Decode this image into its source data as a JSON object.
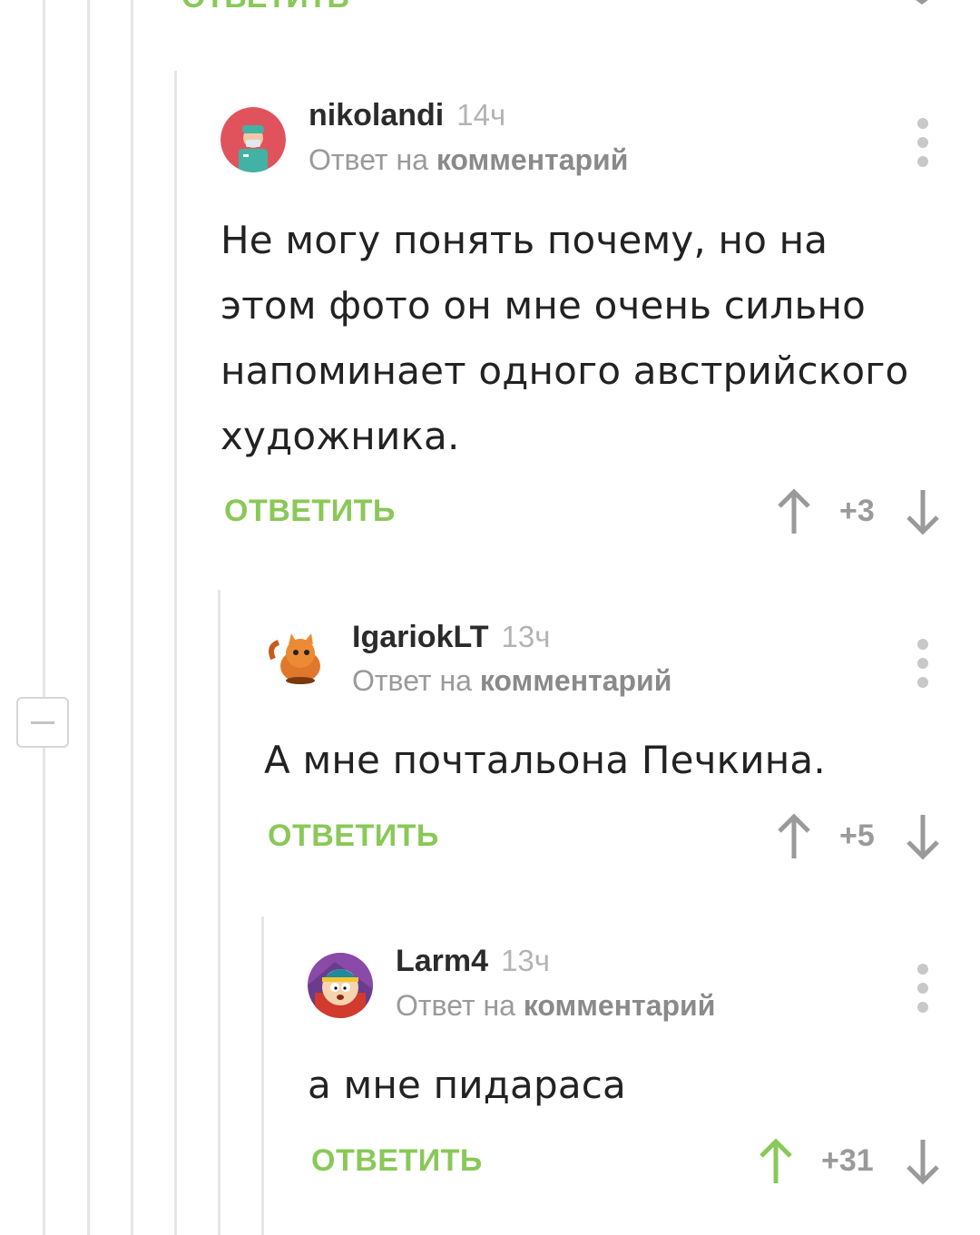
{
  "colors": {
    "accent_green": "#8ac858",
    "muted": "#9a9a9a",
    "thread_line": "#e6e6e6"
  },
  "top_partial": {
    "reply_label": "ОТВЕТИТЬ"
  },
  "collapse_button": {
    "icon": "minus-icon"
  },
  "comments": [
    {
      "author": "nikolandi",
      "time": "14ч",
      "reply_prefix": "Ответ на",
      "reply_link": "комментарий",
      "body_lines": [
        "Не могу понять почему, но на",
        "этом фото он мне очень сильно",
        "напоминает одного австрийского",
        "художника."
      ],
      "reply_label": "ОТВЕТИТЬ",
      "score": "+3",
      "upvoted": false
    },
    {
      "author": "IgariokLT",
      "time": "13ч",
      "reply_prefix": "Ответ на",
      "reply_link": "комментарий",
      "body_lines": [
        "А мне почтальона Печкина."
      ],
      "reply_label": "ОТВЕТИТЬ",
      "score": "+5",
      "upvoted": false
    },
    {
      "author": "Larm4",
      "time": "13ч",
      "reply_prefix": "Ответ на",
      "reply_link": "комментарий",
      "body_lines": [
        "а мне пидараса"
      ],
      "reply_label": "ОТВЕТИТЬ",
      "score": "+31",
      "upvoted": true
    }
  ]
}
